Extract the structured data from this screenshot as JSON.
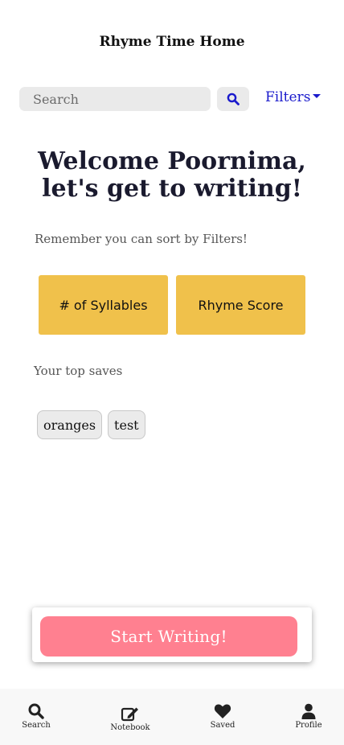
{
  "header": {
    "title": "Rhyme Time Home"
  },
  "search": {
    "placeholder": "Search",
    "value": ""
  },
  "filters": {
    "label": "Filters"
  },
  "welcome": {
    "line1": "Welcome Poornima,",
    "line2": "let's get to writing!"
  },
  "hint": "Remember you can sort by Filters!",
  "sort_buttons": [
    {
      "label": "# of Syllables"
    },
    {
      "label": "Rhyme Score"
    }
  ],
  "saves": {
    "label": "Your top saves",
    "items": [
      "oranges",
      "test"
    ]
  },
  "cta": {
    "label": "Start Writing!"
  },
  "bottom_nav": [
    {
      "label": "Search",
      "icon": "search-icon"
    },
    {
      "label": "Notebook",
      "icon": "edit-icon"
    },
    {
      "label": "Saved",
      "icon": "heart-icon"
    },
    {
      "label": "Profile",
      "icon": "user-icon"
    }
  ],
  "colors": {
    "accent_yellow": "#f0c14b",
    "cta_pink": "#ff8090",
    "link_blue": "#1a1acc",
    "search_icon_blue": "#1a1acc"
  }
}
